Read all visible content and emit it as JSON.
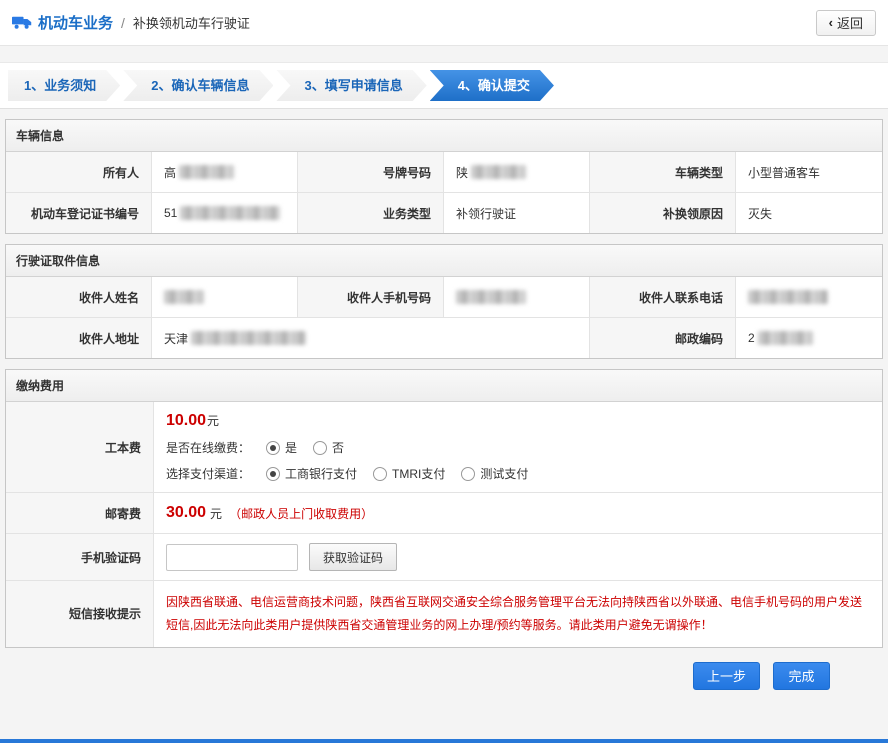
{
  "header": {
    "title_primary": "机动车业务",
    "title_separator": "/",
    "title_secondary": "补换领机动车行驶证",
    "back_chevron": "‹",
    "back_button": "返回"
  },
  "steps": [
    {
      "label": "1、业务须知",
      "active": false
    },
    {
      "label": "2、确认车辆信息",
      "active": false
    },
    {
      "label": "3、填写申请信息",
      "active": false
    },
    {
      "label": "4、确认提交",
      "active": true
    }
  ],
  "vehicle": {
    "title": "车辆信息",
    "owner_label": "所有人",
    "owner_prefix": "高",
    "plate_label": "号牌号码",
    "plate_prefix": "陕",
    "vtype_label": "车辆类型",
    "vtype_value": "小型普通客车",
    "regno_label": "机动车登记证书编号",
    "regno_prefix": "51",
    "biztype_label": "业务类型",
    "biztype_value": "补领行驶证",
    "reason_label": "补换领原因",
    "reason_value": "灭失"
  },
  "pickup": {
    "title": "行驶证取件信息",
    "name_label": "收件人姓名",
    "mobile_label": "收件人手机号码",
    "phone_label": "收件人联系电话",
    "address_label": "收件人地址",
    "address_prefix": "天津",
    "zip_label": "邮政编码",
    "zip_prefix": "2"
  },
  "payment": {
    "title": "缴纳费用",
    "cost_label": "工本费",
    "cost_amount": "10.00",
    "cost_unit": "元",
    "online_label": "是否在线缴费：",
    "online_yes": "是",
    "online_no": "否",
    "channel_label": "选择支付渠道：",
    "channel_options": [
      "工商银行支付",
      "TMRI支付",
      "测试支付"
    ],
    "postage_label": "邮寄费",
    "postage_amount": "30.00",
    "postage_unit": "元",
    "postage_note": "（邮政人员上门收取费用）",
    "captcha_label": "手机验证码",
    "captcha_button": "获取验证码",
    "sms_label": "短信接收提示",
    "sms_text": "因陕西省联通、电信运营商技术问题，陕西省互联网交通安全综合服务管理平台无法向持陕西省以外联通、电信手机号码的用户发送短信,因此无法向此类用户提供陕西省交通管理业务的网上办理/预约等服务。请此类用户避免无谓操作！"
  },
  "footer": {
    "prev_button": "上一步",
    "finish_button": "完成"
  }
}
